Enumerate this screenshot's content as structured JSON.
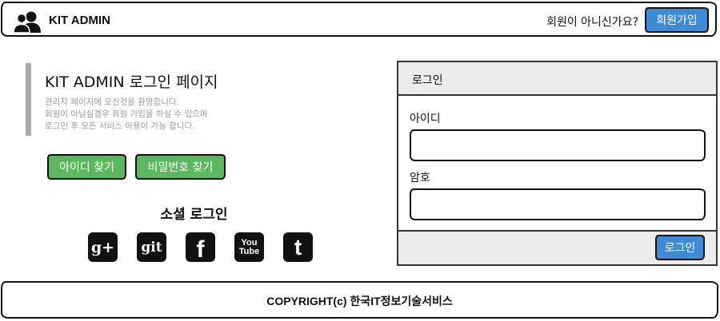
{
  "header": {
    "brand": "KIT ADMIN",
    "not_member_text": "회원이 아니신가요?",
    "signup_label": "회원가입",
    "logo_icon": "users-icon"
  },
  "intro": {
    "title": "KIT ADMIN 로그인 페이지",
    "desc_lines": [
      "관리자 페이지에 오신것을 환영합니다.",
      "회원이 아닐실경우 회원 가입을 하실 수 있으며",
      "로그인 후 모든 서비스 이용이 가능 합니다."
    ],
    "find_id_label": "아이디 찾기",
    "find_pw_label": "비밀번호 찾기"
  },
  "social": {
    "title": "소셜 로그인",
    "icons": [
      {
        "name": "google-plus-icon",
        "glyph": "g+"
      },
      {
        "name": "git-icon",
        "glyph": "git"
      },
      {
        "name": "facebook-icon",
        "glyph": "f"
      },
      {
        "name": "youtube-icon",
        "glyph": "You Tube"
      },
      {
        "name": "tumblr-icon",
        "glyph": "t"
      }
    ]
  },
  "login": {
    "panel_title": "로그인",
    "id_label": "아이디",
    "id_value": "",
    "pw_label": "암호",
    "pw_value": "",
    "submit_label": "로그인"
  },
  "footer": {
    "copyright": "COPYRIGHT(c) 한국IT정보기술서비스"
  },
  "colors": {
    "primary_blue": "#3d8bd6",
    "success_green": "#5cb85c",
    "panel_gray": "#ececec",
    "muted_text": "#9a9a9a"
  }
}
